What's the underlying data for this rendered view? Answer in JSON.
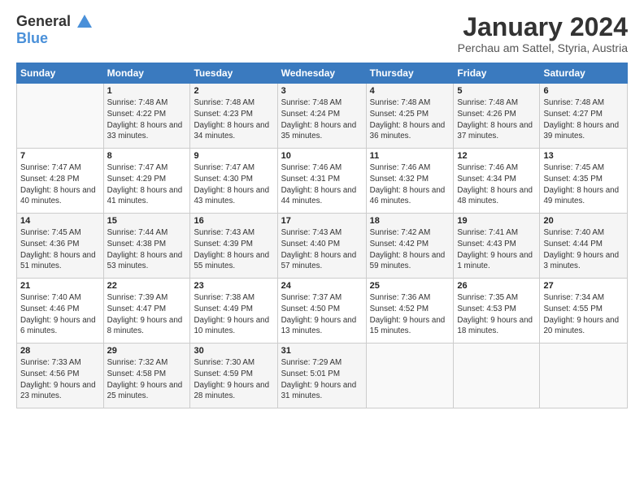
{
  "header": {
    "logo_line1": "General",
    "logo_line2": "Blue",
    "month_year": "January 2024",
    "location": "Perchau am Sattel, Styria, Austria"
  },
  "days_of_week": [
    "Sunday",
    "Monday",
    "Tuesday",
    "Wednesday",
    "Thursday",
    "Friday",
    "Saturday"
  ],
  "weeks": [
    [
      {
        "day": "",
        "sunrise": "",
        "sunset": "",
        "daylight": ""
      },
      {
        "day": "1",
        "sunrise": "Sunrise: 7:48 AM",
        "sunset": "Sunset: 4:22 PM",
        "daylight": "Daylight: 8 hours and 33 minutes."
      },
      {
        "day": "2",
        "sunrise": "Sunrise: 7:48 AM",
        "sunset": "Sunset: 4:23 PM",
        "daylight": "Daylight: 8 hours and 34 minutes."
      },
      {
        "day": "3",
        "sunrise": "Sunrise: 7:48 AM",
        "sunset": "Sunset: 4:24 PM",
        "daylight": "Daylight: 8 hours and 35 minutes."
      },
      {
        "day": "4",
        "sunrise": "Sunrise: 7:48 AM",
        "sunset": "Sunset: 4:25 PM",
        "daylight": "Daylight: 8 hours and 36 minutes."
      },
      {
        "day": "5",
        "sunrise": "Sunrise: 7:48 AM",
        "sunset": "Sunset: 4:26 PM",
        "daylight": "Daylight: 8 hours and 37 minutes."
      },
      {
        "day": "6",
        "sunrise": "Sunrise: 7:48 AM",
        "sunset": "Sunset: 4:27 PM",
        "daylight": "Daylight: 8 hours and 39 minutes."
      }
    ],
    [
      {
        "day": "7",
        "sunrise": "Sunrise: 7:47 AM",
        "sunset": "Sunset: 4:28 PM",
        "daylight": "Daylight: 8 hours and 40 minutes."
      },
      {
        "day": "8",
        "sunrise": "Sunrise: 7:47 AM",
        "sunset": "Sunset: 4:29 PM",
        "daylight": "Daylight: 8 hours and 41 minutes."
      },
      {
        "day": "9",
        "sunrise": "Sunrise: 7:47 AM",
        "sunset": "Sunset: 4:30 PM",
        "daylight": "Daylight: 8 hours and 43 minutes."
      },
      {
        "day": "10",
        "sunrise": "Sunrise: 7:46 AM",
        "sunset": "Sunset: 4:31 PM",
        "daylight": "Daylight: 8 hours and 44 minutes."
      },
      {
        "day": "11",
        "sunrise": "Sunrise: 7:46 AM",
        "sunset": "Sunset: 4:32 PM",
        "daylight": "Daylight: 8 hours and 46 minutes."
      },
      {
        "day": "12",
        "sunrise": "Sunrise: 7:46 AM",
        "sunset": "Sunset: 4:34 PM",
        "daylight": "Daylight: 8 hours and 48 minutes."
      },
      {
        "day": "13",
        "sunrise": "Sunrise: 7:45 AM",
        "sunset": "Sunset: 4:35 PM",
        "daylight": "Daylight: 8 hours and 49 minutes."
      }
    ],
    [
      {
        "day": "14",
        "sunrise": "Sunrise: 7:45 AM",
        "sunset": "Sunset: 4:36 PM",
        "daylight": "Daylight: 8 hours and 51 minutes."
      },
      {
        "day": "15",
        "sunrise": "Sunrise: 7:44 AM",
        "sunset": "Sunset: 4:38 PM",
        "daylight": "Daylight: 8 hours and 53 minutes."
      },
      {
        "day": "16",
        "sunrise": "Sunrise: 7:43 AM",
        "sunset": "Sunset: 4:39 PM",
        "daylight": "Daylight: 8 hours and 55 minutes."
      },
      {
        "day": "17",
        "sunrise": "Sunrise: 7:43 AM",
        "sunset": "Sunset: 4:40 PM",
        "daylight": "Daylight: 8 hours and 57 minutes."
      },
      {
        "day": "18",
        "sunrise": "Sunrise: 7:42 AM",
        "sunset": "Sunset: 4:42 PM",
        "daylight": "Daylight: 8 hours and 59 minutes."
      },
      {
        "day": "19",
        "sunrise": "Sunrise: 7:41 AM",
        "sunset": "Sunset: 4:43 PM",
        "daylight": "Daylight: 9 hours and 1 minute."
      },
      {
        "day": "20",
        "sunrise": "Sunrise: 7:40 AM",
        "sunset": "Sunset: 4:44 PM",
        "daylight": "Daylight: 9 hours and 3 minutes."
      }
    ],
    [
      {
        "day": "21",
        "sunrise": "Sunrise: 7:40 AM",
        "sunset": "Sunset: 4:46 PM",
        "daylight": "Daylight: 9 hours and 6 minutes."
      },
      {
        "day": "22",
        "sunrise": "Sunrise: 7:39 AM",
        "sunset": "Sunset: 4:47 PM",
        "daylight": "Daylight: 9 hours and 8 minutes."
      },
      {
        "day": "23",
        "sunrise": "Sunrise: 7:38 AM",
        "sunset": "Sunset: 4:49 PM",
        "daylight": "Daylight: 9 hours and 10 minutes."
      },
      {
        "day": "24",
        "sunrise": "Sunrise: 7:37 AM",
        "sunset": "Sunset: 4:50 PM",
        "daylight": "Daylight: 9 hours and 13 minutes."
      },
      {
        "day": "25",
        "sunrise": "Sunrise: 7:36 AM",
        "sunset": "Sunset: 4:52 PM",
        "daylight": "Daylight: 9 hours and 15 minutes."
      },
      {
        "day": "26",
        "sunrise": "Sunrise: 7:35 AM",
        "sunset": "Sunset: 4:53 PM",
        "daylight": "Daylight: 9 hours and 18 minutes."
      },
      {
        "day": "27",
        "sunrise": "Sunrise: 7:34 AM",
        "sunset": "Sunset: 4:55 PM",
        "daylight": "Daylight: 9 hours and 20 minutes."
      }
    ],
    [
      {
        "day": "28",
        "sunrise": "Sunrise: 7:33 AM",
        "sunset": "Sunset: 4:56 PM",
        "daylight": "Daylight: 9 hours and 23 minutes."
      },
      {
        "day": "29",
        "sunrise": "Sunrise: 7:32 AM",
        "sunset": "Sunset: 4:58 PM",
        "daylight": "Daylight: 9 hours and 25 minutes."
      },
      {
        "day": "30",
        "sunrise": "Sunrise: 7:30 AM",
        "sunset": "Sunset: 4:59 PM",
        "daylight": "Daylight: 9 hours and 28 minutes."
      },
      {
        "day": "31",
        "sunrise": "Sunrise: 7:29 AM",
        "sunset": "Sunset: 5:01 PM",
        "daylight": "Daylight: 9 hours and 31 minutes."
      },
      {
        "day": "",
        "sunrise": "",
        "sunset": "",
        "daylight": ""
      },
      {
        "day": "",
        "sunrise": "",
        "sunset": "",
        "daylight": ""
      },
      {
        "day": "",
        "sunrise": "",
        "sunset": "",
        "daylight": ""
      }
    ]
  ]
}
